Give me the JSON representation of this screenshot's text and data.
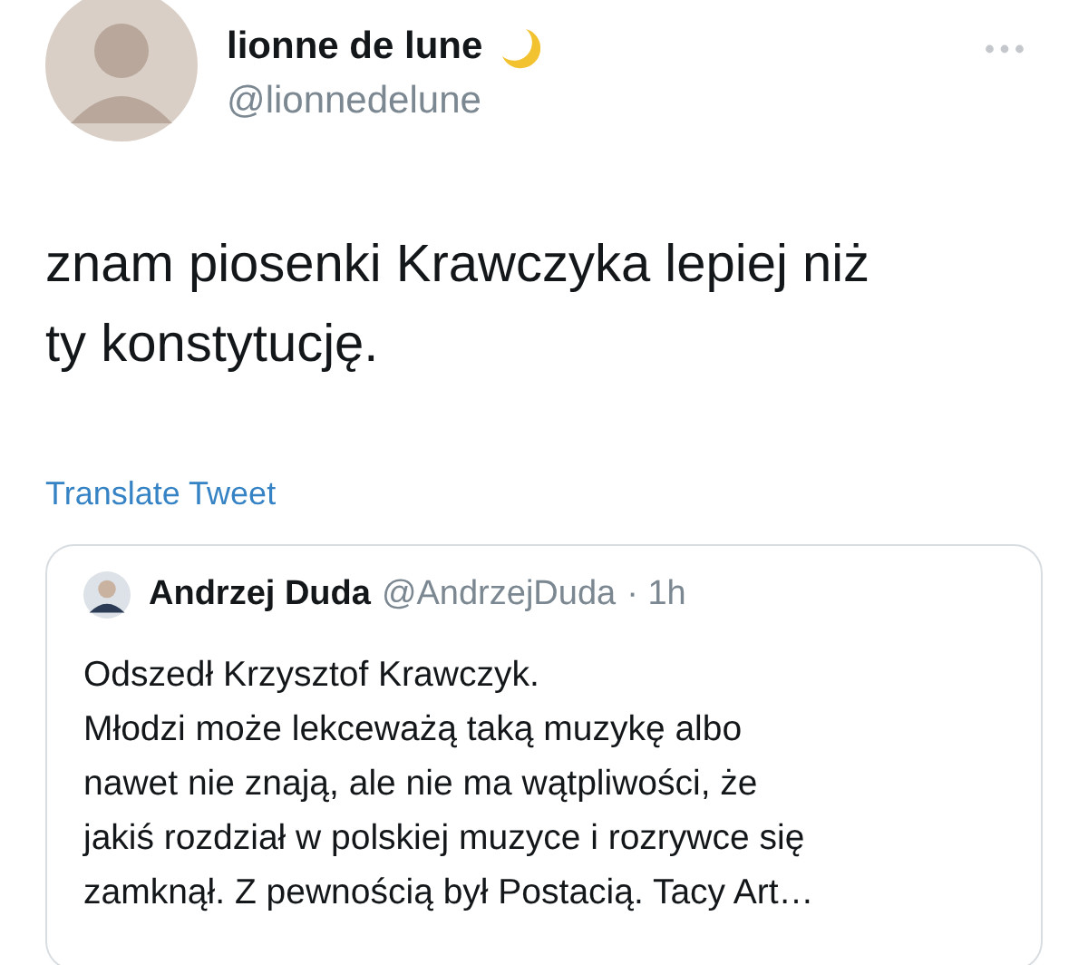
{
  "author": {
    "name": "lionne de lune",
    "handle": "@lionnedelune"
  },
  "tweet_lines": [
    "znam piosenki Krawczyka lepiej niż",
    "ty konstytucję."
  ],
  "translate_link": "Translate Tweet",
  "quoted": {
    "name": "Andrzej Duda",
    "handle": "@AndrzejDuda",
    "time": "· 1h",
    "lines": [
      "Odszedł Krzysztof Krawczyk.",
      "Młodzi może lekceważą taką muzykę albo",
      "nawet nie znają, ale nie ma wątpliwości, że",
      "jakiś rozdział w polskiej muzyce i rozrywce się",
      "zamknął. Z pewnością był Postacią. Tacy Art…"
    ]
  }
}
